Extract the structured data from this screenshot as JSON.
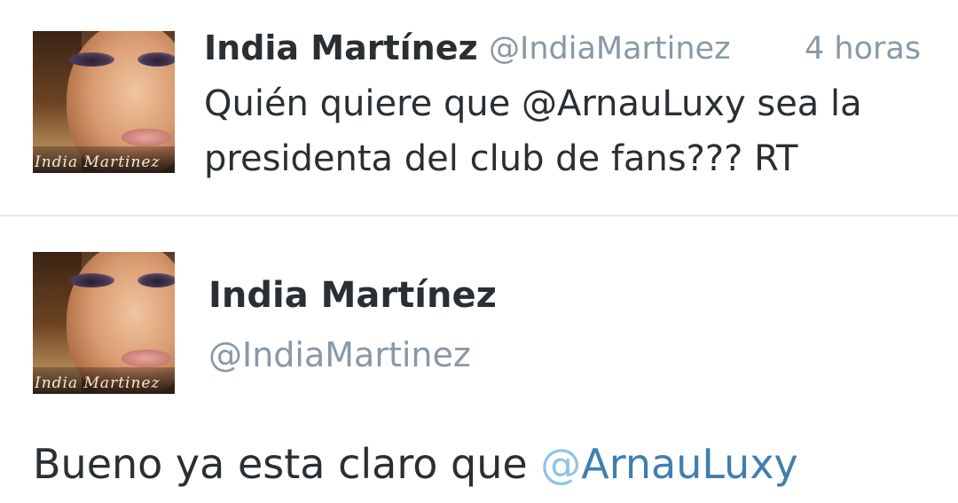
{
  "tweet1": {
    "avatar_signature": "India Martinez",
    "name": "India Martínez",
    "handle": "@IndiaMartinez",
    "time": "4 horas",
    "text_line1": "Quién quiere que @ArnauLuxy sea la",
    "text_line2": "presidenta del club de fans??? RT"
  },
  "tweet2": {
    "avatar_signature": "India Martinez",
    "name": "India Martínez",
    "handle": "@IndiaMartinez",
    "text_plain": "Bueno ya esta claro que ",
    "mention_at": "@",
    "mention_user": "ArnauLuxy"
  },
  "colors": {
    "name_text": "#292f33",
    "secondary_text": "#8899a6",
    "divider": "#e1e8ed",
    "mention": "#3f7fb0",
    "mention_at": "#8fc3e8"
  }
}
